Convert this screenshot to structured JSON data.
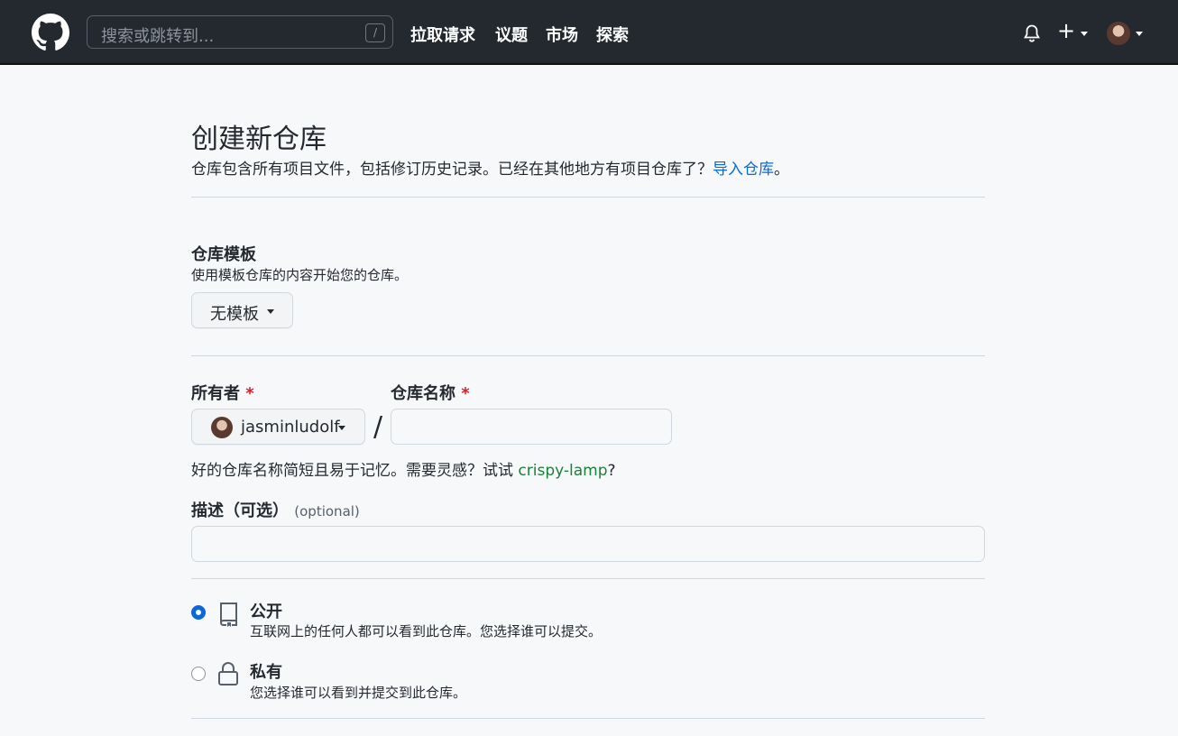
{
  "header": {
    "search_placeholder": "搜索或跳转到...",
    "search_shortcut": "/",
    "nav": [
      "拉取请求",
      "议题",
      "市场",
      "探索"
    ]
  },
  "main": {
    "title": "创建新仓库",
    "subtitle_text": "仓库包含所有项目文件，包括修订历史记录。已经在其他地方有项目仓库了？",
    "import_link": "导入仓库",
    "subtitle_end": "。",
    "template": {
      "label": "仓库模板",
      "help": "使用模板仓库的内容开始您的仓库。",
      "selected": "无模板"
    },
    "owner": {
      "label": "所有者",
      "required": "*",
      "value": "jasminludolf"
    },
    "separator": "/",
    "repo_name": {
      "label": "仓库名称",
      "required": "*",
      "value": ""
    },
    "suggestion": {
      "text": "好的仓库名称简短且易于记忆。需要灵感？试试 ",
      "name": "crispy-lamp",
      "end": "?"
    },
    "description": {
      "label": "描述（可选）",
      "optional": "(optional)",
      "value": ""
    },
    "visibility": [
      {
        "title": "公开",
        "desc": "互联网上的任何人都可以看到此仓库。您选择谁可以提交。",
        "checked": true,
        "icon": "repo-icon"
      },
      {
        "title": "私有",
        "desc": "您选择谁可以看到并提交到此仓库。",
        "checked": false,
        "icon": "lock-icon"
      }
    ]
  },
  "colors": {
    "header_bg": "#24292f",
    "link_blue": "#0969da",
    "link_green": "#1a7f37",
    "required_red": "#cf222e"
  }
}
